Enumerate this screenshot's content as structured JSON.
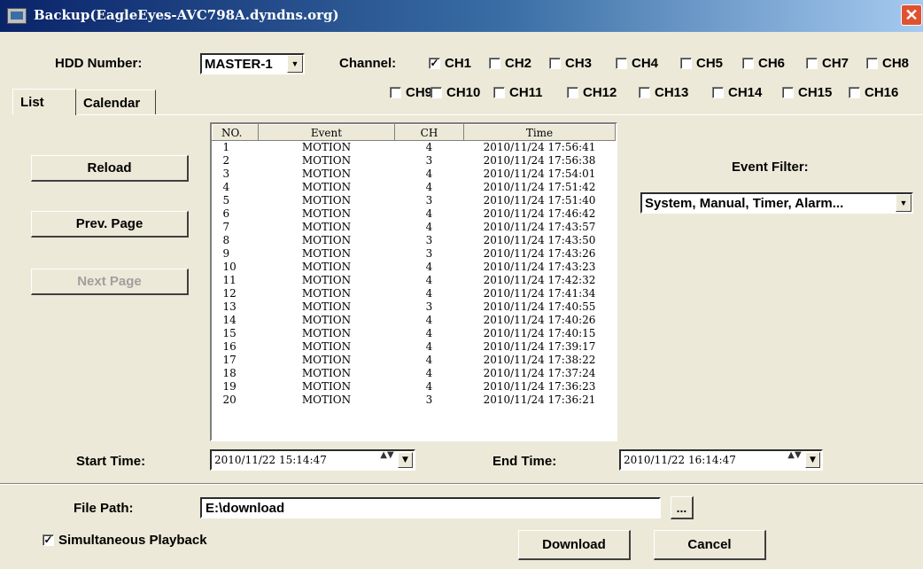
{
  "window": {
    "title": "Backup(EagleEyes-AVC798A.dyndns.org)",
    "close_glyph": "✕"
  },
  "hdd": {
    "label": "HDD Number:",
    "value": "MASTER-1"
  },
  "channel": {
    "label": "Channel:",
    "items": [
      {
        "label": "CH1",
        "checked": "✓"
      },
      {
        "label": "CH2",
        "checked": ""
      },
      {
        "label": "CH3",
        "checked": ""
      },
      {
        "label": "CH4",
        "checked": ""
      },
      {
        "label": "CH5",
        "checked": ""
      },
      {
        "label": "CH6",
        "checked": ""
      },
      {
        "label": "CH7",
        "checked": ""
      },
      {
        "label": "CH8",
        "checked": ""
      },
      {
        "label": "CH9",
        "checked": ""
      },
      {
        "label": "CH10",
        "checked": ""
      },
      {
        "label": "CH11",
        "checked": ""
      },
      {
        "label": "CH12",
        "checked": ""
      },
      {
        "label": "CH13",
        "checked": ""
      },
      {
        "label": "CH14",
        "checked": ""
      },
      {
        "label": "CH15",
        "checked": ""
      },
      {
        "label": "CH16",
        "checked": ""
      }
    ]
  },
  "tabs": {
    "list": "List",
    "calendar": "Calendar"
  },
  "buttons": {
    "reload": "Reload",
    "prev": "Prev. Page",
    "next": "Next Page",
    "download": "Download",
    "cancel": "Cancel",
    "browse": "..."
  },
  "table": {
    "headers": {
      "no": "NO.",
      "event": "Event",
      "ch": "CH",
      "time": "Time"
    },
    "rows": [
      {
        "no": "1",
        "event": "MOTION",
        "ch": "4",
        "time": "2010/11/24 17:56:41"
      },
      {
        "no": "2",
        "event": "MOTION",
        "ch": "3",
        "time": "2010/11/24 17:56:38"
      },
      {
        "no": "3",
        "event": "MOTION",
        "ch": "4",
        "time": "2010/11/24 17:54:01"
      },
      {
        "no": "4",
        "event": "MOTION",
        "ch": "4",
        "time": "2010/11/24 17:51:42"
      },
      {
        "no": "5",
        "event": "MOTION",
        "ch": "3",
        "time": "2010/11/24 17:51:40"
      },
      {
        "no": "6",
        "event": "MOTION",
        "ch": "4",
        "time": "2010/11/24 17:46:42"
      },
      {
        "no": "7",
        "event": "MOTION",
        "ch": "4",
        "time": "2010/11/24 17:43:57"
      },
      {
        "no": "8",
        "event": "MOTION",
        "ch": "3",
        "time": "2010/11/24 17:43:50"
      },
      {
        "no": "9",
        "event": "MOTION",
        "ch": "3",
        "time": "2010/11/24 17:43:26"
      },
      {
        "no": "10",
        "event": "MOTION",
        "ch": "4",
        "time": "2010/11/24 17:43:23"
      },
      {
        "no": "11",
        "event": "MOTION",
        "ch": "4",
        "time": "2010/11/24 17:42:32"
      },
      {
        "no": "12",
        "event": "MOTION",
        "ch": "4",
        "time": "2010/11/24 17:41:34"
      },
      {
        "no": "13",
        "event": "MOTION",
        "ch": "3",
        "time": "2010/11/24 17:40:55"
      },
      {
        "no": "14",
        "event": "MOTION",
        "ch": "4",
        "time": "2010/11/24 17:40:26"
      },
      {
        "no": "15",
        "event": "MOTION",
        "ch": "4",
        "time": "2010/11/24 17:40:15"
      },
      {
        "no": "16",
        "event": "MOTION",
        "ch": "4",
        "time": "2010/11/24 17:39:17"
      },
      {
        "no": "17",
        "event": "MOTION",
        "ch": "4",
        "time": "2010/11/24 17:38:22"
      },
      {
        "no": "18",
        "event": "MOTION",
        "ch": "4",
        "time": "2010/11/24 17:37:24"
      },
      {
        "no": "19",
        "event": "MOTION",
        "ch": "4",
        "time": "2010/11/24 17:36:23"
      },
      {
        "no": "20",
        "event": "MOTION",
        "ch": "3",
        "time": "2010/11/24 17:36:21"
      }
    ]
  },
  "event_filter": {
    "label": "Event Filter:",
    "value": "System, Manual, Timer, Alarm..."
  },
  "start_time": {
    "label": "Start Time:",
    "value": "2010/11/22 15:14:47"
  },
  "end_time": {
    "label": "End Time:",
    "value": "2010/11/22 16:14:47"
  },
  "file_path": {
    "label": "File Path:",
    "value": "E:\\download"
  },
  "simultaneous": {
    "label": "Simultaneous Playback",
    "checked": "✓"
  },
  "icons": {
    "dropdown": "▼",
    "spin": "▲▼"
  }
}
